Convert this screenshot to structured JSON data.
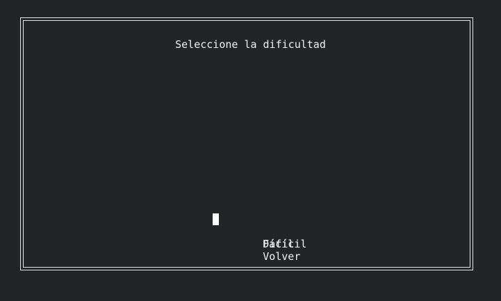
{
  "screen": {
    "title": "Seleccione la dificultad"
  },
  "menu": {
    "items": [
      {
        "label": "Fácil",
        "selected": true
      },
      {
        "label": "Difícil",
        "selected": false
      },
      {
        "label": "Volver",
        "selected": false
      }
    ]
  },
  "colors": {
    "background": "#232425",
    "text": "#f2f2f2",
    "border": "#e6e6e6",
    "cursor": "#ffffff"
  }
}
